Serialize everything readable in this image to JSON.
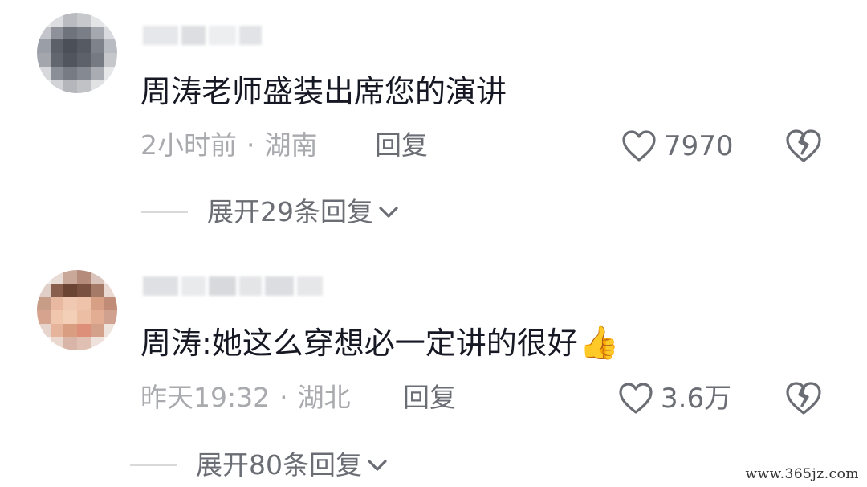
{
  "comments": [
    {
      "text": "周涛老师盛装出席您的演讲",
      "emoji": "",
      "time": "2小时前",
      "location": "湖南",
      "reply_label": "回复",
      "likes": "7970",
      "expand_label": "展开29条回复",
      "avatar_colors": [
        "#e9eaec",
        "#dcdde0",
        "#b9bbc0",
        "#c7c8cc",
        "#e4e5e7",
        "#f1f1f2",
        "#c3c5ca",
        "#8e9199",
        "#6f737c",
        "#7a7e87",
        "#a5a8af",
        "#d9dadd",
        "#9a9ea6",
        "#5b6069",
        "#4a4f58",
        "#555a63",
        "#7d828b",
        "#b8bbc1",
        "#a3a6ad",
        "#62666f",
        "#50555e",
        "#5d6169",
        "#767b83",
        "#c5c7cb",
        "#d7d8db",
        "#8a8e96",
        "#777b83",
        "#858991",
        "#a9acb2",
        "#e6e7e9",
        "#f0f0f1",
        "#d2d3d6",
        "#b4b6bb",
        "#c0c2c6",
        "#e1e2e4",
        "#f5f5f6"
      ],
      "username_colors": [
        "#e6e7ea",
        "#dcdee1",
        "#eceef0",
        "#e2e3e6"
      ]
    },
    {
      "text": "周涛:她这么穿想必一定讲的很好",
      "emoji": "👍",
      "time": "昨天19:32",
      "location": "湖北",
      "reply_label": "回复",
      "likes": "3.6万",
      "expand_label": "展开80条回复",
      "avatar_colors": [
        "#f3eeec",
        "#e9dcd6",
        "#c9a89a",
        "#b58b7b",
        "#d9c3ba",
        "#f5f0ee",
        "#e0cfc7",
        "#8a5e4c",
        "#6b4434",
        "#7a5140",
        "#a57a66",
        "#ead9d2",
        "#c89d88",
        "#e8b9a0",
        "#f1c9b2",
        "#eec3aa",
        "#d79f84",
        "#c08c77",
        "#d6a48e",
        "#f0c6ad",
        "#f4cfb8",
        "#ecbfa5",
        "#e2ad92",
        "#cfa18e",
        "#e7d4cc",
        "#e6b39b",
        "#d99e82",
        "#de8f79",
        "#d3a08a",
        "#efe3de",
        "#f6f1ef",
        "#ead8cf",
        "#d8b5a6",
        "#dfc0b2",
        "#efe2dc",
        "#f7f3f2"
      ],
      "username_colors": [
        "#dfe0e3",
        "#e9eaec",
        "#d8d9dc",
        "#e4e5e7",
        "#dcdde0",
        "#e6e7e9"
      ]
    }
  ],
  "watermark": "www.365jz.com",
  "icons": {
    "like": "heart-outline-icon",
    "dislike": "broken-heart-icon",
    "expand": "chevron-down-icon"
  },
  "colors": {
    "text": "#161823",
    "meta": "#a9aaae",
    "action": "#6b6d74"
  }
}
